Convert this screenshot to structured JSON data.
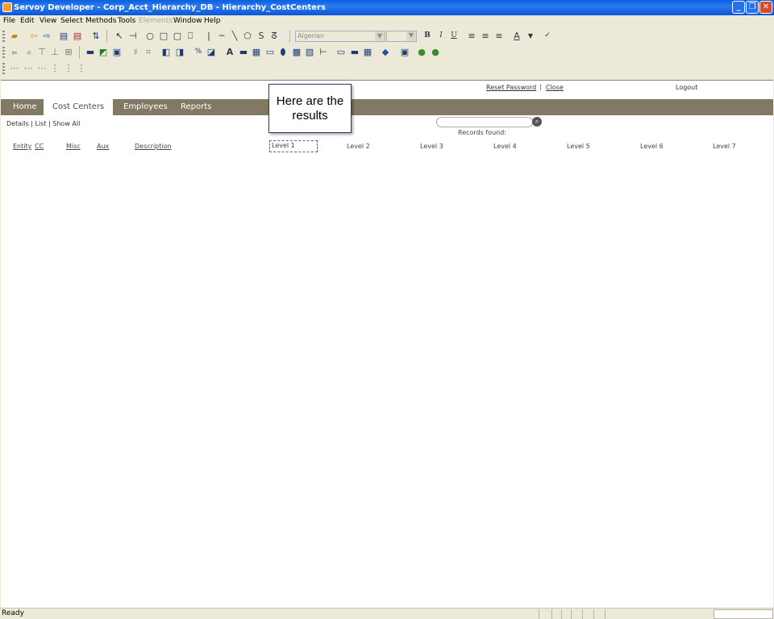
{
  "window": {
    "title": "Servoy Developer - Corp_Acct_Hierarchy_DB - Hierarchy_CostCenters"
  },
  "menu": {
    "items": [
      "File",
      "Edit",
      "View",
      "Select",
      "Methods",
      "Tools",
      "Elements",
      "Window",
      "Help"
    ]
  },
  "toolbar": {
    "font_name": "Algerian",
    "font_size": ""
  },
  "form": {
    "top_links": {
      "reset_password": "Reset Password",
      "separator": "|",
      "close": "Close",
      "logout": "Logout"
    },
    "tabs": [
      {
        "label": "Home",
        "active": false
      },
      {
        "label": "Cost Centers",
        "active": true
      },
      {
        "label": "Employees",
        "active": false
      },
      {
        "label": "Reports",
        "active": false
      }
    ],
    "view_links": "Details | List | Show All",
    "search": {
      "value": "",
      "records_label": "Records found:"
    },
    "columns": [
      "Entity",
      "CC",
      "Misc",
      "Aux",
      "Description",
      "Level 1",
      "Level 2",
      "Level 3",
      "Level 4",
      "Level 5",
      "Level 6",
      "Level 7"
    ]
  },
  "callout": {
    "text": "Here are the results"
  },
  "status": {
    "text": "Ready"
  },
  "colors": {
    "titlebar": "#0a5fe0",
    "tabstrip": "#827965",
    "chrome": "#ece9d8"
  }
}
